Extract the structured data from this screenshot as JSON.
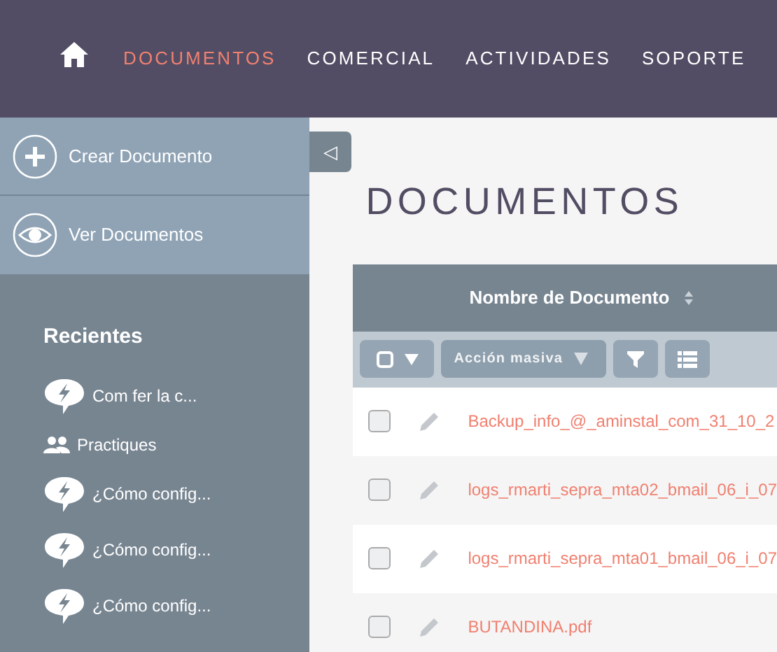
{
  "nav": [
    {
      "label": "DOCUMENTOS",
      "selected": true
    },
    {
      "label": "COMERCIAL",
      "selected": false
    },
    {
      "label": "ACTIVIDADES",
      "selected": false
    },
    {
      "label": "SOPORTE",
      "selected": false
    }
  ],
  "sidebar": {
    "actions": [
      {
        "kind": "create",
        "label": "Crear Documento"
      },
      {
        "kind": "view",
        "label": "Ver Documentos"
      }
    ],
    "recent_title": "Recientes",
    "recent": [
      {
        "kind": "bug",
        "label": "Com fer la c..."
      },
      {
        "kind": "people",
        "label": "Practiques"
      },
      {
        "kind": "bug",
        "label": "¿Cómo config..."
      },
      {
        "kind": "bug",
        "label": "¿Cómo config..."
      },
      {
        "kind": "bug",
        "label": "¿Cómo config..."
      }
    ]
  },
  "toggle": "◁",
  "page_title": "DOCUMENTOS",
  "table": {
    "columns": [
      "Nombre de Documento"
    ],
    "bulk_action": "Acción masiva",
    "rows": [
      {
        "name": "Backup_info_@_aminstal_com_31_10_2",
        "checked": false
      },
      {
        "name": "logs_rmarti_sepra_mta02_bmail_06_i_07",
        "checked": false
      },
      {
        "name": "logs_rmarti_sepra_mta01_bmail_06_i_07",
        "checked": false
      },
      {
        "name": "BUTANDINA.pdf",
        "checked": false
      }
    ]
  }
}
